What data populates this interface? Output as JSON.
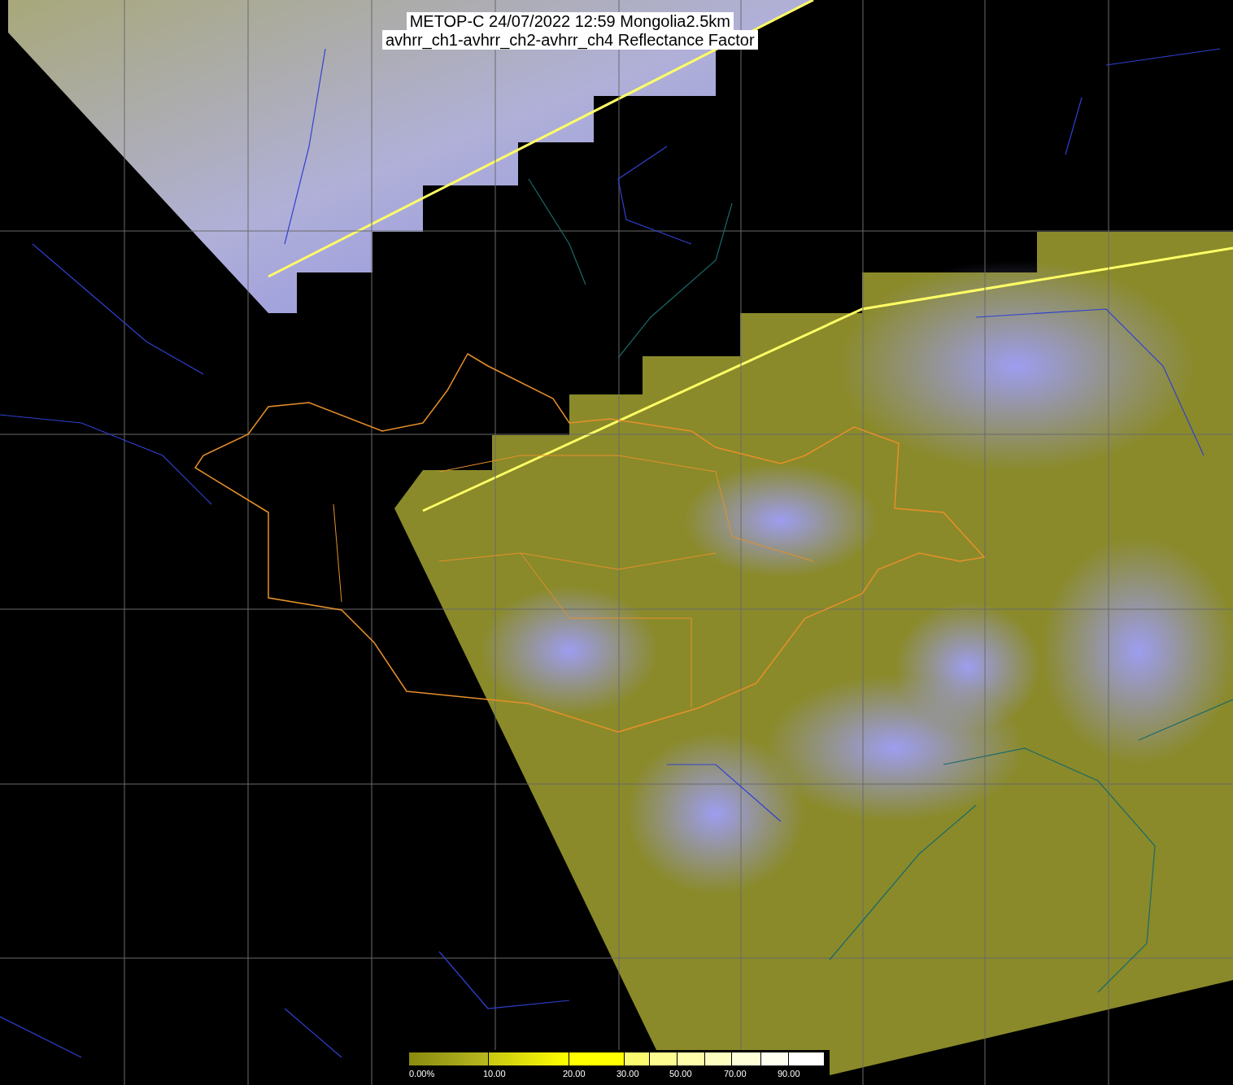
{
  "title": {
    "lines": [
      "METOP-C 24/07/2022 12:59 Mongolia2.5km",
      "avhrr_ch1-avhrr_ch2-avhrr_ch4 Reflectance Factor"
    ]
  },
  "colorbar": {
    "labels": [
      "0.00%",
      "10.00",
      "20.00",
      "30.00",
      "50.00",
      "70.00",
      "90.00"
    ]
  }
}
